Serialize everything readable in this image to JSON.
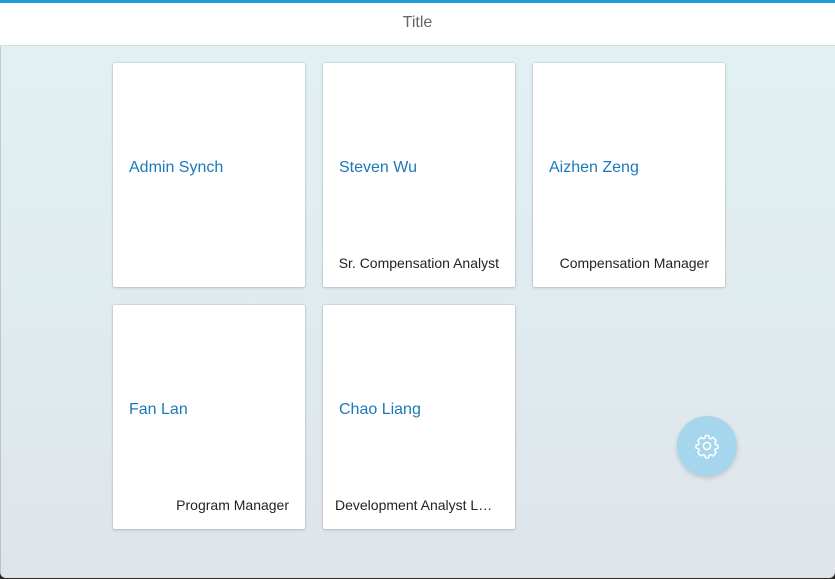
{
  "header": {
    "title": "Title"
  },
  "tiles": [
    {
      "name": "Admin Synch",
      "role": ""
    },
    {
      "name": "Steven Wu",
      "role": "Sr. Compensation Analyst"
    },
    {
      "name": "Aizhen Zeng",
      "role": "Compensation Manager"
    },
    {
      "name": "Fan Lan",
      "role": "Program Manager"
    },
    {
      "name": "Chao Liang",
      "role": "Development Analyst Lead"
    }
  ],
  "settings_button": {
    "icon": "gear-icon"
  },
  "colors": {
    "accent": "#1d9bd8",
    "name_text": "#1a79b8",
    "fab_bg": "#a6d6ee"
  }
}
